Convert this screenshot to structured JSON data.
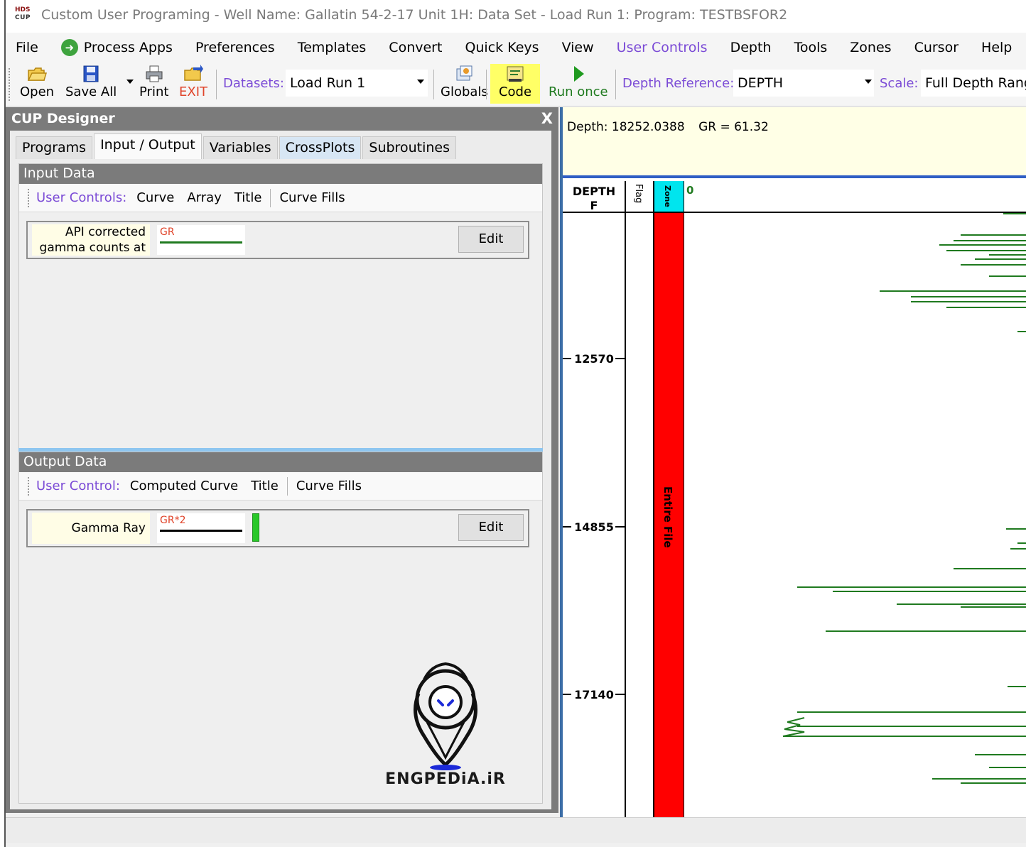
{
  "window": {
    "logo_line1": "HDS",
    "logo_line2": "CUP",
    "title": "Custom User Programing - Well Name: Gallatin 54-2-17 Unit 1H: Data Set - Load Run 1: Program: TESTBSFOR2"
  },
  "menu": {
    "items": [
      "File",
      "Process Apps",
      "Preferences",
      "Templates",
      "Convert",
      "Quick Keys",
      "View",
      "User Controls",
      "Depth",
      "Tools",
      "Zones",
      "Cursor",
      "Help"
    ]
  },
  "toolbar": {
    "open": "Open",
    "save_all": "Save All",
    "print": "Print",
    "exit": "EXIT",
    "datasets_label": "Datasets:",
    "datasets_value": "Load Run 1",
    "globals": "Globals",
    "code": "Code",
    "run_once": "Run once",
    "depth_ref_label": "Depth Reference:",
    "depth_ref_value": "DEPTH",
    "scale_label": "Scale:",
    "scale_value": "Full Depth Range"
  },
  "designer": {
    "title": "CUP Designer",
    "close": "X",
    "tabs": [
      "Programs",
      "Input / Output",
      "Variables",
      "CrossPlots",
      "Subroutines"
    ],
    "input": {
      "title": "Input Data",
      "bar_label": "User Controls:",
      "bar_items": [
        "Curve",
        "Array",
        "Title"
      ],
      "bar_items2": [
        "Curve Fills"
      ],
      "row": {
        "description": "API corrected gamma counts at",
        "curve_name": "GR",
        "edit": "Edit",
        "line_color": "#1f7a1f"
      }
    },
    "output": {
      "title": "Output Data",
      "bar_label": "User Control:",
      "bar_items": [
        "Computed Curve",
        "Title"
      ],
      "bar_items2": [
        "Curve Fills"
      ],
      "row": {
        "description": "Gamma Ray",
        "curve_name": "GR*2",
        "edit": "Edit",
        "line_color": "#000000",
        "fill_color": "#28c828"
      }
    },
    "watermark": "ENGPEDiA.iR"
  },
  "logview": {
    "readout_depth": "Depth: 18252.0388",
    "readout_gr": "GR = 61.32",
    "header_depth": "DEPTH",
    "header_unit": "F",
    "header_flag": "Flag",
    "header_zone": "Zone",
    "header_scale_min": "0",
    "zone_label": "Entire File",
    "zone_color": "#ff0000",
    "zone_header_color": "#00e5ee",
    "curve_color": "#1f7a1f",
    "depth_ticks": [
      "12570",
      "14855",
      "17140"
    ]
  }
}
